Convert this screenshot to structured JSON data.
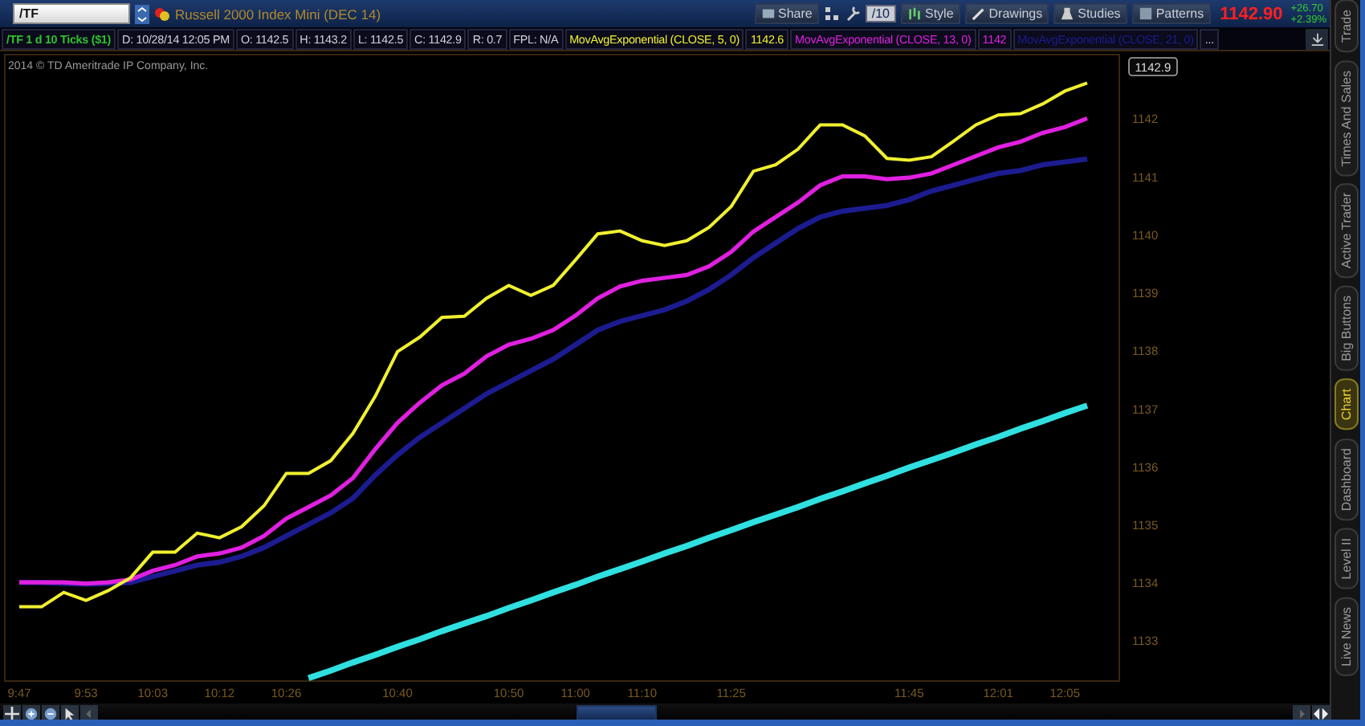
{
  "symbol": {
    "value": "/TF",
    "description": "Russell 2000 Index Mini (DEC 14)"
  },
  "toolbar": {
    "share": "Share",
    "interval": "/10",
    "style": "Style",
    "drawings": "Drawings",
    "studies": "Studies",
    "patterns": "Patterns"
  },
  "quote": {
    "last": "1142.90",
    "change": "+26.70",
    "change_percent": "+2.39%"
  },
  "info_bar": {
    "chart_label": "/TF 1 d 10 Ticks ($1)",
    "fields": [
      "D: 10/28/14 12:05 PM",
      "O: 1142.5",
      "H: 1143.2",
      "L: 1142.5",
      "C: 1142.9",
      "R: 0.7",
      "FPL: N/A"
    ],
    "study_readouts": [
      "1142.6",
      "1142"
    ],
    "more": "..."
  },
  "copyright": "2014 © TD Ameritrade IP Company, Inc.",
  "price_label": "1142.9",
  "chart_data": {
    "type": "line",
    "categories": [
      "9:47",
      null,
      null,
      "9:53",
      null,
      null,
      "10:03",
      null,
      null,
      "10:12",
      null,
      null,
      "10:26",
      null,
      null,
      null,
      null,
      "10:40",
      null,
      null,
      null,
      null,
      "10:50",
      null,
      null,
      "11:00",
      null,
      null,
      "11:10",
      null,
      null,
      null,
      "11:25",
      null,
      null,
      null,
      null,
      null,
      null,
      null,
      "11:45",
      null,
      null,
      null,
      "12:01",
      null,
      null,
      "12:05",
      null
    ],
    "series": [
      {
        "name": "MovAvgExponential (CLOSE, 5, 0)",
        "color": "#f0f030",
        "values": [
          1133.58,
          1133.58,
          1133.83,
          1133.69,
          1133.86,
          1134.08,
          1134.52,
          1134.52,
          1134.85,
          1134.77,
          1134.96,
          1135.32,
          1135.88,
          1135.88,
          1136.1,
          1136.57,
          1137.21,
          1137.98,
          1138.23,
          1138.57,
          1138.59,
          1138.9,
          1139.12,
          1138.95,
          1139.12,
          1139.56,
          1140.01,
          1140.06,
          1139.89,
          1139.81,
          1139.89,
          1140.12,
          1140.48,
          1141.09,
          1141.2,
          1141.47,
          1141.89,
          1141.89,
          1141.7,
          1141.31,
          1141.28,
          1141.34,
          1141.61,
          1141.89,
          1142.06,
          1142.08,
          1142.25,
          1142.47,
          1142.61
        ]
      },
      {
        "name": "MovAvgExponential (CLOSE, 13, 0)",
        "color": "#e020e0",
        "values": [
          1134.0,
          1134.0,
          1134.0,
          1133.98,
          1134.0,
          1134.05,
          1134.2,
          1134.3,
          1134.45,
          1134.5,
          1134.6,
          1134.8,
          1135.1,
          1135.3,
          1135.5,
          1135.8,
          1136.3,
          1136.75,
          1137.1,
          1137.4,
          1137.6,
          1137.9,
          1138.1,
          1138.2,
          1138.35,
          1138.6,
          1138.9,
          1139.1,
          1139.2,
          1139.25,
          1139.3,
          1139.45,
          1139.7,
          1140.05,
          1140.3,
          1140.55,
          1140.85,
          1141.0,
          1141.0,
          1140.95,
          1140.98,
          1141.05,
          1141.2,
          1141.35,
          1141.5,
          1141.6,
          1141.75,
          1141.85,
          1142.0
        ]
      },
      {
        "name": "MovAvgExponential (CLOSE, 21, 0)",
        "color": "#1c1c90",
        "values": [
          1134.0,
          1134.0,
          1133.98,
          1133.97,
          1133.98,
          1134.0,
          1134.1,
          1134.2,
          1134.3,
          1134.35,
          1134.45,
          1134.6,
          1134.8,
          1135.0,
          1135.2,
          1135.45,
          1135.85,
          1136.2,
          1136.5,
          1136.75,
          1137.0,
          1137.25,
          1137.45,
          1137.65,
          1137.85,
          1138.1,
          1138.35,
          1138.5,
          1138.6,
          1138.7,
          1138.85,
          1139.05,
          1139.3,
          1139.6,
          1139.85,
          1140.1,
          1140.3,
          1140.4,
          1140.45,
          1140.5,
          1140.6,
          1140.75,
          1140.85,
          1140.95,
          1141.05,
          1141.1,
          1141.2,
          1141.25,
          1141.3
        ]
      },
      {
        "color": "#30e0e0",
        "values": [
          null,
          null,
          null,
          null,
          null,
          null,
          null,
          null,
          null,
          null,
          null,
          null,
          null,
          1132.35,
          1132.48,
          1132.62,
          1132.75,
          1132.89,
          1133.02,
          1133.16,
          1133.29,
          1133.42,
          1133.56,
          1133.69,
          1133.83,
          1133.96,
          1134.1,
          1134.23,
          1134.36,
          1134.5,
          1134.63,
          1134.77,
          1134.9,
          1135.04,
          1135.17,
          1135.3,
          1135.44,
          1135.57,
          1135.71,
          1135.84,
          1135.98,
          1136.11,
          1136.24,
          1136.38,
          1136.51,
          1136.65,
          1136.78,
          1136.92,
          1137.05
        ]
      }
    ],
    "ylim": [
      1132.3,
      1143.1
    ],
    "yticks": [
      1133,
      1134,
      1135,
      1136,
      1137,
      1138,
      1139,
      1140,
      1141,
      1142
    ]
  },
  "sidebar": {
    "tabs": [
      {
        "label": "Trade",
        "selected": false
      },
      {
        "label": "Times And Sales",
        "selected": false
      },
      {
        "label": "Active Trader",
        "selected": false
      },
      {
        "label": "Big Buttons",
        "selected": false
      },
      {
        "label": "Chart",
        "selected": true
      },
      {
        "label": "Dashboard",
        "selected": false
      },
      {
        "label": "Level II",
        "selected": false
      },
      {
        "label": "Live News",
        "selected": false
      }
    ]
  }
}
